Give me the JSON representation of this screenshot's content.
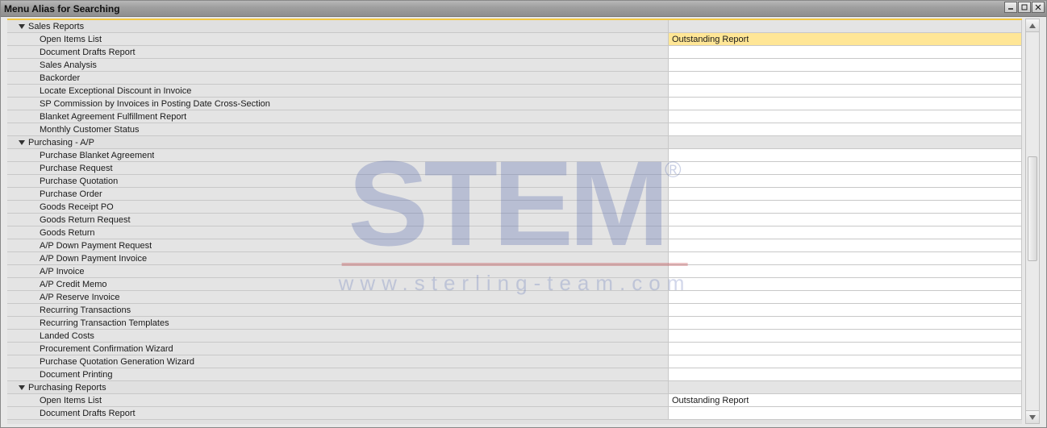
{
  "window": {
    "title": "Menu Alias for Searching"
  },
  "watermark": {
    "brand": "STEM",
    "reg": "®",
    "url": "www.sterling-team.com"
  },
  "rows": [
    {
      "type": "header",
      "label": "Sales Reports",
      "alias": "",
      "interact": true
    },
    {
      "type": "child",
      "label": "Open Items List",
      "alias": "Outstanding Report",
      "highlight": true,
      "interact": true
    },
    {
      "type": "child",
      "label": "Document Drafts Report",
      "alias": "",
      "interact": true
    },
    {
      "type": "child",
      "label": "Sales Analysis",
      "alias": "",
      "interact": true
    },
    {
      "type": "child",
      "label": "Backorder",
      "alias": "",
      "interact": true
    },
    {
      "type": "child",
      "label": "Locate Exceptional Discount in Invoice",
      "alias": "",
      "interact": true
    },
    {
      "type": "child",
      "label": "SP Commission by Invoices in Posting Date Cross-Section",
      "alias": "",
      "interact": true
    },
    {
      "type": "child",
      "label": "Blanket Agreement Fulfillment Report",
      "alias": "",
      "interact": true
    },
    {
      "type": "child",
      "label": "Monthly Customer Status",
      "alias": "",
      "interact": true
    },
    {
      "type": "header",
      "label": "Purchasing - A/P",
      "alias": "",
      "interact": true
    },
    {
      "type": "child",
      "label": "Purchase Blanket Agreement",
      "alias": "",
      "interact": true
    },
    {
      "type": "child",
      "label": "Purchase Request",
      "alias": "",
      "interact": true
    },
    {
      "type": "child",
      "label": "Purchase Quotation",
      "alias": "",
      "interact": true
    },
    {
      "type": "child",
      "label": "Purchase Order",
      "alias": "",
      "interact": true
    },
    {
      "type": "child",
      "label": "Goods Receipt PO",
      "alias": "",
      "interact": true
    },
    {
      "type": "child",
      "label": "Goods Return Request",
      "alias": "",
      "interact": true
    },
    {
      "type": "child",
      "label": "Goods Return",
      "alias": "",
      "interact": true
    },
    {
      "type": "child",
      "label": "A/P Down Payment Request",
      "alias": "",
      "interact": true
    },
    {
      "type": "child",
      "label": "A/P Down Payment Invoice",
      "alias": "",
      "interact": true
    },
    {
      "type": "child",
      "label": "A/P Invoice",
      "alias": "",
      "interact": true
    },
    {
      "type": "child",
      "label": "A/P Credit Memo",
      "alias": "",
      "interact": true
    },
    {
      "type": "child",
      "label": "A/P Reserve Invoice",
      "alias": "",
      "interact": true
    },
    {
      "type": "child",
      "label": "Recurring Transactions",
      "alias": "",
      "interact": true
    },
    {
      "type": "child",
      "label": "Recurring Transaction Templates",
      "alias": "",
      "interact": true
    },
    {
      "type": "child",
      "label": "Landed Costs",
      "alias": "",
      "interact": true
    },
    {
      "type": "child",
      "label": "Procurement Confirmation Wizard",
      "alias": "",
      "interact": true
    },
    {
      "type": "child",
      "label": "Purchase Quotation Generation Wizard",
      "alias": "",
      "interact": true
    },
    {
      "type": "child",
      "label": "Document Printing",
      "alias": "",
      "interact": true
    },
    {
      "type": "header",
      "label": "Purchasing Reports",
      "alias": "",
      "interact": true
    },
    {
      "type": "child",
      "label": "Open Items List",
      "alias": "Outstanding Report",
      "interact": true
    },
    {
      "type": "child",
      "label": "Document Drafts Report",
      "alias": "",
      "interact": true
    }
  ]
}
